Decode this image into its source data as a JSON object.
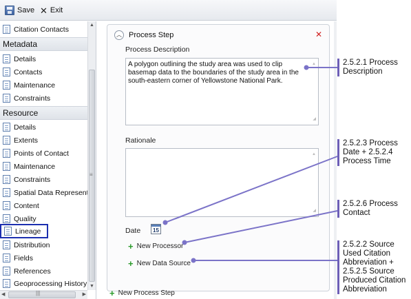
{
  "toolbar": {
    "save_label": "Save",
    "exit_label": "Exit"
  },
  "sidebar": {
    "top_item": "Citation Contacts",
    "metadata_header": "Metadata",
    "metadata_items": [
      "Details",
      "Contacts",
      "Maintenance",
      "Constraints"
    ],
    "resource_header": "Resource",
    "resource_items": [
      "Details",
      "Extents",
      "Points of Contact",
      "Maintenance",
      "Constraints",
      "Spatial Data Representat",
      "Content",
      "Quality",
      "Lineage",
      "Distribution",
      "Fields",
      "References",
      "Geoprocessing History"
    ],
    "selected_item": "Lineage"
  },
  "panel": {
    "title": "Process Step",
    "description_label": "Process Description",
    "description_value": "A polygon outlining the study area was used to clip basemap data to the boundaries of the study area in the south-eastern corner of Yellowstone National Park.",
    "rationale_label": "Rationale",
    "rationale_value": "",
    "date_label": "Date",
    "calendar_day": "15",
    "new_processor_label": "New Processor",
    "new_data_source_label": "New Data Source"
  },
  "new_process_step_label": "New Process Step",
  "annotations": [
    "2.5.2.1 Process Description",
    "2.5.2.3 Process Date + 2.5.2.4 Process Time",
    "2.5.2.6 Process Contact",
    "2.5.2.2 Source Used Citation Abbreviation + 2.5.2.5 Source Produced Citation Abbreviation"
  ],
  "colors": {
    "accent": "#7b73c8",
    "selection": "#1c2fb0",
    "close": "#d02020",
    "add": "#2a9a2a"
  },
  "icons": [
    "save-icon",
    "exit-icon",
    "document-icon",
    "collapse-icon",
    "close-icon",
    "calendar-icon",
    "plus-icon"
  ]
}
